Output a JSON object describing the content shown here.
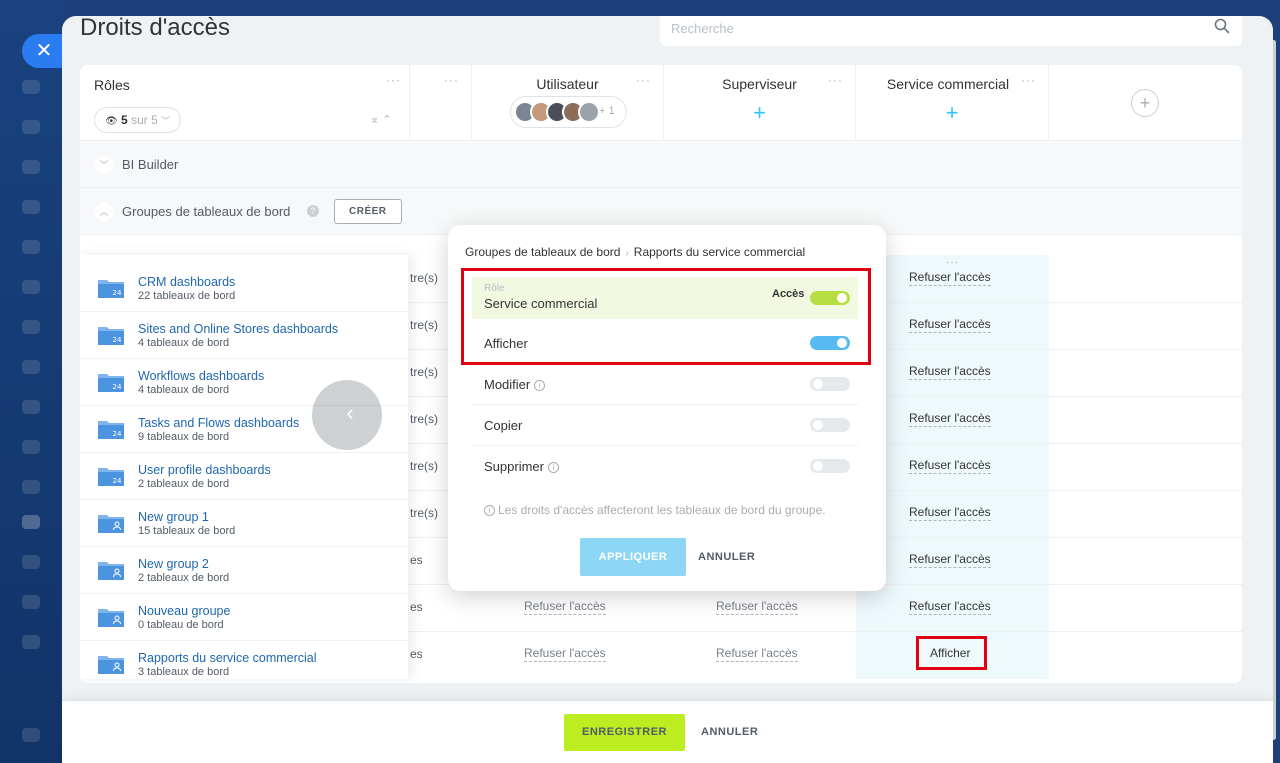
{
  "page": {
    "title": "Droits d'accès"
  },
  "search": {
    "placeholder": "Recherche"
  },
  "roles_header": {
    "label": "Rôles",
    "count_shown": "5",
    "count_total": "sur 5"
  },
  "columns": [
    {
      "name": "Utilisateur",
      "avatars_more": "+ 1"
    },
    {
      "name": "Superviseur"
    },
    {
      "name": "Service commercial"
    }
  ],
  "sections": {
    "bi_builder": "BI Builder",
    "groups": "Groupes de tableaux de bord",
    "create_label": "CRÉER"
  },
  "groups": [
    {
      "name": "CRM dashboards",
      "count": "22 tableaux de bord",
      "icon": "bitrix24-folder-icon"
    },
    {
      "name": "Sites and Online Stores dashboards",
      "count": "4 tableaux de bord",
      "icon": "bitrix24-folder-icon"
    },
    {
      "name": "Workflows dashboards",
      "count": "4 tableaux de bord",
      "icon": "bitrix24-folder-icon"
    },
    {
      "name": "Tasks and Flows dashboards",
      "count": "9 tableaux de bord",
      "icon": "bitrix24-folder-icon"
    },
    {
      "name": "User profile dashboards",
      "count": "2 tableaux de bord",
      "icon": "bitrix24-folder-icon"
    },
    {
      "name": "New group 1",
      "count": "15 tableaux de bord",
      "icon": "user-folder-icon"
    },
    {
      "name": "New group 2",
      "count": "2 tableaux de bord",
      "icon": "user-folder-icon"
    },
    {
      "name": "Nouveau groupe",
      "count": "0 tableau de bord",
      "icon": "user-folder-icon"
    },
    {
      "name": "Rapports du service commercial",
      "count": "3 tableaux de bord",
      "icon": "user-folder-icon"
    }
  ],
  "clipped_cells": [
    "tre(s)",
    "tre(s)",
    "tre(s)",
    "tre(s)",
    "tre(s)",
    "tre(s)",
    "es",
    "es",
    "es"
  ],
  "user_cells": {
    "row8": "Refuser l'accès",
    "row9": "Refuser l'accès"
  },
  "supervisor_cells": {
    "row8": "Refuser l'accès",
    "row9": "Refuser l'accès"
  },
  "service_cells": [
    "Refuser l'accès",
    "Refuser l'accès",
    "Refuser l'accès",
    "Refuser l'accès",
    "Refuser l'accès",
    "Refuser l'accès",
    "Refuser l'accès",
    "Refuser l'accès",
    "Afficher"
  ],
  "popup": {
    "breadcrumb_parent": "Groupes de tableaux de bord",
    "breadcrumb_current": "Rapports du service commercial",
    "role_label": "Rôle",
    "role_value": "Service commercial",
    "access_label": "Accès",
    "access_on": true,
    "permissions": [
      {
        "label": "Afficher",
        "on": true,
        "info": false
      },
      {
        "label": "Modifier",
        "on": false,
        "info": true
      },
      {
        "label": "Copier",
        "on": false,
        "info": false
      },
      {
        "label": "Supprimer",
        "on": false,
        "info": true
      }
    ],
    "note": "Les droits d'accès affecteront les tableaux de bord du groupe.",
    "apply": "APPLIQUER",
    "cancel": "ANNULER"
  },
  "footer": {
    "save": "ENREGISTRER",
    "cancel": "ANNULER"
  },
  "colors": {
    "accent_blue": "#2fc6f6",
    "save_green": "#bbed21",
    "highlight_red": "#e0000f",
    "link_blue": "#2067b0"
  }
}
